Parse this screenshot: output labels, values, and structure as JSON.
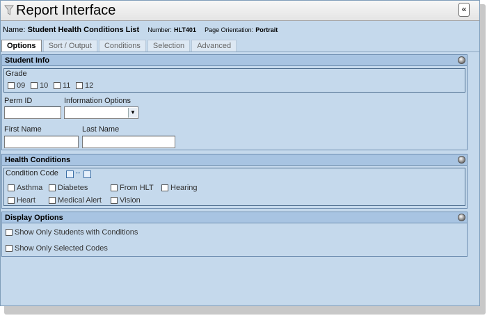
{
  "window": {
    "title": "Report Interface",
    "collapse_label": "«"
  },
  "report_info": {
    "name_label": "Name:",
    "name_value": "Student Health Conditions List",
    "number_label": "Number:",
    "number_value": "HLT401",
    "orientation_label": "Page Orientation:",
    "orientation_value": "Portrait"
  },
  "tabs": [
    {
      "label": "Options",
      "active": true
    },
    {
      "label": "Sort / Output",
      "active": false
    },
    {
      "label": "Conditions",
      "active": false
    },
    {
      "label": "Selection",
      "active": false
    },
    {
      "label": "Advanced",
      "active": false
    }
  ],
  "student_info": {
    "header": "Student Info",
    "grade": {
      "label": "Grade",
      "options": [
        {
          "label": "09",
          "checked": false
        },
        {
          "label": "10",
          "checked": false
        },
        {
          "label": "11",
          "checked": false
        },
        {
          "label": "12",
          "checked": false
        }
      ]
    },
    "perm_id": {
      "label": "Perm ID",
      "value": ""
    },
    "information_options": {
      "label": "Information Options",
      "value": ""
    },
    "first_name": {
      "label": "First Name",
      "value": ""
    },
    "last_name": {
      "label": "Last Name",
      "value": ""
    }
  },
  "health_conditions": {
    "header": "Health Conditions",
    "condition_code_label": "Condition Code",
    "codes": [
      {
        "label": "Asthma",
        "checked": false
      },
      {
        "label": "Diabetes",
        "checked": false
      },
      {
        "label": "From HLT",
        "checked": false
      },
      {
        "label": "Hearing",
        "checked": false
      },
      {
        "label": "Heart",
        "checked": false
      },
      {
        "label": "Medical Alert",
        "checked": false
      },
      {
        "label": "Vision",
        "checked": false
      }
    ]
  },
  "display_options": {
    "header": "Display Options",
    "options": [
      {
        "label": "Show Only Students with Conditions",
        "checked": false
      },
      {
        "label": "Show Only Selected Codes",
        "checked": false
      }
    ]
  },
  "colors": {
    "window_bg": "#c5d9ec",
    "section_header_bg": "#a8c4e2",
    "border": "#6f8fb1"
  }
}
